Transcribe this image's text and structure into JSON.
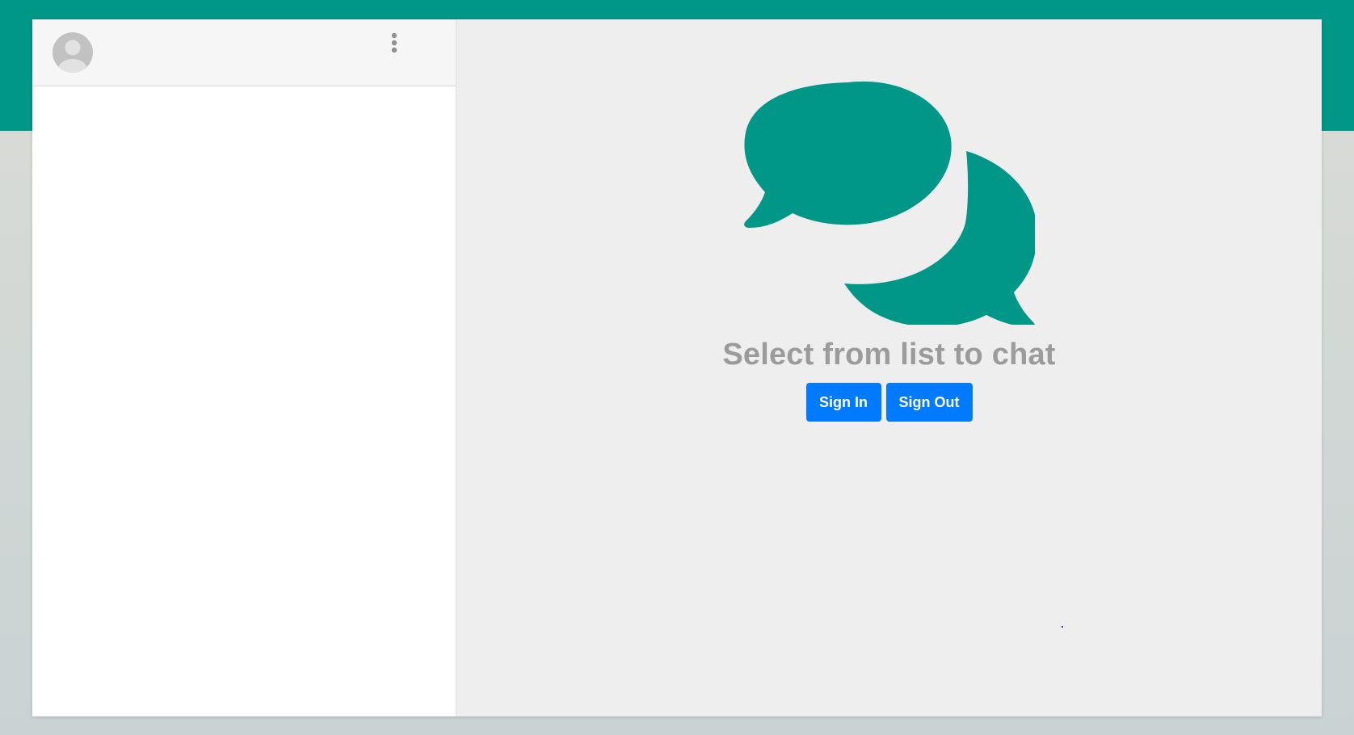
{
  "sidebar": {
    "avatar_icon": "user-avatar-icon",
    "menu_icon": "more-vertical-icon"
  },
  "main": {
    "empty_icon": "chat-bubbles-icon",
    "empty_title": "Select from list to chat",
    "sign_in_label": "Sign In",
    "sign_out_label": "Sign Out"
  },
  "colors": {
    "brand_teal": "#009688",
    "button_blue": "#007bff",
    "panel_bg": "#eeeeee",
    "title_gray": "#9b9b9b"
  }
}
